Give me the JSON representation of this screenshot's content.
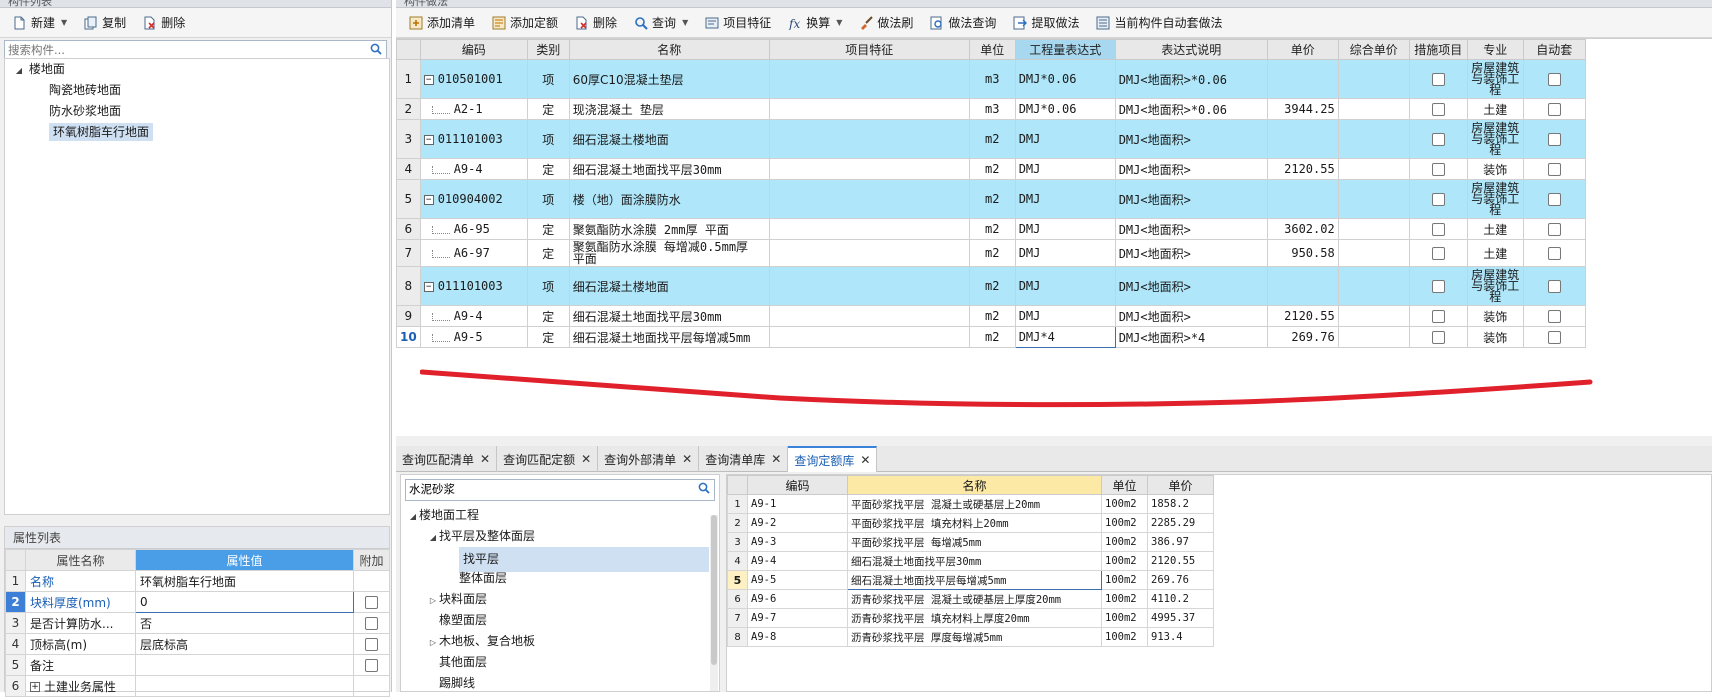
{
  "left_panel": {
    "title": "构件列表",
    "toolbar": [
      {
        "label": "新建",
        "icon": "new-doc-icon",
        "dropdown": true
      },
      {
        "label": "复制",
        "icon": "copy-icon",
        "dropdown": false
      },
      {
        "label": "删除",
        "icon": "delete-icon",
        "dropdown": false
      }
    ],
    "search_placeholder": "搜索构件...",
    "tree": {
      "root": "楼地面",
      "children": [
        "陶瓷地砖地面",
        "防水砂浆地面",
        "环氧树脂车行地面"
      ],
      "selected": "环氧树脂车行地面"
    }
  },
  "props_panel": {
    "title": "属性列表",
    "headers": [
      "属性名称",
      "属性值",
      "附加"
    ],
    "rows": [
      {
        "idx": "1",
        "name": "名称",
        "value": "环氧树脂车行地面",
        "has_check": false
      },
      {
        "idx": "2",
        "name": "块料厚度(mm)",
        "value": "0",
        "has_check": true
      },
      {
        "idx": "3",
        "name": "是否计算防水...",
        "value": "否",
        "has_check": true
      },
      {
        "idx": "4",
        "name": "顶标高(m)",
        "value": "层底标高",
        "has_check": true
      },
      {
        "idx": "5",
        "name": "备注",
        "value": "",
        "has_check": true
      },
      {
        "idx": "6",
        "name": "土建业务属性",
        "value": "",
        "has_check": false
      }
    ]
  },
  "main_panel": {
    "title": "构件做法",
    "toolbar": [
      {
        "label": "添加清单",
        "icon": "add-list-icon",
        "dropdown": false
      },
      {
        "label": "添加定额",
        "icon": "add-quota-icon",
        "dropdown": false
      },
      {
        "label": "删除",
        "icon": "delete-icon",
        "dropdown": false
      },
      {
        "label": "查询",
        "icon": "query-icon",
        "dropdown": true
      },
      {
        "label": "项目特征",
        "icon": "feature-icon",
        "dropdown": false
      },
      {
        "label": "换算",
        "icon": "fx-icon",
        "dropdown": true
      },
      {
        "label": "做法刷",
        "icon": "brush-icon",
        "dropdown": false
      },
      {
        "label": "做法查询",
        "icon": "method-query-icon",
        "dropdown": false
      },
      {
        "label": "提取做法",
        "icon": "extract-icon",
        "dropdown": false
      },
      {
        "label": "当前构件自动套做法",
        "icon": "auto-apply-icon",
        "dropdown": false
      }
    ],
    "headers": [
      "编码",
      "类别",
      "名称",
      "项目特征",
      "单位",
      "工程量表达式",
      "表达式说明",
      "单价",
      "综合单价",
      "措施项目",
      "专业",
      "自动套"
    ],
    "rows": [
      {
        "no": "1",
        "type": "qd",
        "code": "010501001",
        "cat": "项",
        "name": "60厚C10混凝土垫层",
        "unit": "m3",
        "expr": "DMJ*0.06",
        "desc": "DMJ<地面积>*0.06",
        "price": "",
        "major": "房屋建筑与装饰工程"
      },
      {
        "no": "2",
        "type": "de",
        "code": "A2-1",
        "cat": "定",
        "name": "现浇混凝土 垫层",
        "unit": "m3",
        "expr": "DMJ*0.06",
        "desc": "DMJ<地面积>*0.06",
        "price": "3944.25",
        "major": "土建"
      },
      {
        "no": "3",
        "type": "qd",
        "code": "011101003",
        "cat": "项",
        "name": "细石混凝土楼地面",
        "unit": "m2",
        "expr": "DMJ",
        "desc": "DMJ<地面积>",
        "price": "",
        "major": "房屋建筑与装饰工程"
      },
      {
        "no": "4",
        "type": "de",
        "code": "A9-4",
        "cat": "定",
        "name": "细石混凝土地面找平层30mm",
        "unit": "m2",
        "expr": "DMJ",
        "desc": "DMJ<地面积>",
        "price": "2120.55",
        "major": "装饰"
      },
      {
        "no": "5",
        "type": "qd",
        "code": "010904002",
        "cat": "项",
        "name": "楼（地）面涂膜防水",
        "unit": "m2",
        "expr": "DMJ",
        "desc": "DMJ<地面积>",
        "price": "",
        "major": "房屋建筑与装饰工程"
      },
      {
        "no": "6",
        "type": "de",
        "code": "A6-95",
        "cat": "定",
        "name": "聚氨酯防水涂膜 2mm厚 平面",
        "unit": "m2",
        "expr": "DMJ",
        "desc": "DMJ<地面积>",
        "price": "3602.02",
        "major": "土建"
      },
      {
        "no": "7",
        "type": "de",
        "code": "A6-97",
        "cat": "定",
        "name": "聚氨酯防水涂膜 每增减0.5mm厚 平面",
        "unit": "m2",
        "expr": "DMJ",
        "desc": "DMJ<地面积>",
        "price": "950.58",
        "major": "土建"
      },
      {
        "no": "8",
        "type": "qd",
        "code": "011101003",
        "cat": "项",
        "name": "细石混凝土楼地面",
        "unit": "m2",
        "expr": "DMJ",
        "desc": "DMJ<地面积>",
        "price": "",
        "major": "房屋建筑与装饰工程"
      },
      {
        "no": "9",
        "type": "de",
        "code": "A9-4",
        "cat": "定",
        "name": "细石混凝土地面找平层30mm",
        "unit": "m2",
        "expr": "DMJ",
        "desc": "DMJ<地面积>",
        "price": "2120.55",
        "major": "装饰"
      },
      {
        "no": "10",
        "type": "de",
        "code": "A9-5",
        "cat": "定",
        "name": "细石混凝土地面找平层每增减5mm",
        "unit": "m2",
        "expr": "DMJ*4",
        "desc": "DMJ<地面积>*4",
        "price": "269.76",
        "major": "装饰"
      }
    ],
    "active_row": "10",
    "annotation_color": "#e0202a"
  },
  "bottom_tabs": [
    {
      "label": "查询匹配清单",
      "active": false
    },
    {
      "label": "查询匹配定额",
      "active": false
    },
    {
      "label": "查询外部清单",
      "active": false
    },
    {
      "label": "查询清单库",
      "active": false
    },
    {
      "label": "查询定额库",
      "active": true
    }
  ],
  "quota_lib": {
    "search_value": "水泥砂浆",
    "tree": [
      {
        "label": "楼地面工程",
        "level": 0,
        "toggle": "open"
      },
      {
        "label": "找平层及整体面层",
        "level": 1,
        "toggle": "open"
      },
      {
        "label": "找平层",
        "level": 2,
        "toggle": "",
        "selected": true
      },
      {
        "label": "整体面层",
        "level": 2,
        "toggle": ""
      },
      {
        "label": "块料面层",
        "level": 1,
        "toggle": "closed"
      },
      {
        "label": "橡塑面层",
        "level": 1,
        "toggle": ""
      },
      {
        "label": "木地板、复合地板",
        "level": 1,
        "toggle": "closed"
      },
      {
        "label": "其他面层",
        "level": 1,
        "toggle": ""
      },
      {
        "label": "踢脚线",
        "level": 1,
        "toggle": ""
      }
    ],
    "headers": [
      "编码",
      "名称",
      "单位",
      "单价"
    ],
    "rows": [
      {
        "no": "1",
        "code": "A9-1",
        "name": "平面砂浆找平层 混凝土或硬基层上20mm",
        "unit": "100m2",
        "price": "1858.2"
      },
      {
        "no": "2",
        "code": "A9-2",
        "name": "平面砂浆找平层 填充材料上20mm",
        "unit": "100m2",
        "price": "2285.29"
      },
      {
        "no": "3",
        "code": "A9-3",
        "name": "平面砂浆找平层 每增减5mm",
        "unit": "100m2",
        "price": "386.97"
      },
      {
        "no": "4",
        "code": "A9-4",
        "name": "细石混凝土地面找平层30mm",
        "unit": "100m2",
        "price": "2120.55"
      },
      {
        "no": "5",
        "code": "A9-5",
        "name": "细石混凝土地面找平层每增减5mm",
        "unit": "100m2",
        "price": "269.76"
      },
      {
        "no": "6",
        "code": "A9-6",
        "name": "沥青砂浆找平层 混凝土或硬基层上厚度20mm",
        "unit": "100m2",
        "price": "4110.2"
      },
      {
        "no": "7",
        "code": "A9-7",
        "name": "沥青砂浆找平层 填充材料上厚度20mm",
        "unit": "100m2",
        "price": "4995.37"
      },
      {
        "no": "8",
        "code": "A9-8",
        "name": "沥青砂浆找平层 厚度每增减5mm",
        "unit": "100m2",
        "price": "913.4"
      }
    ],
    "active_row": "5"
  }
}
